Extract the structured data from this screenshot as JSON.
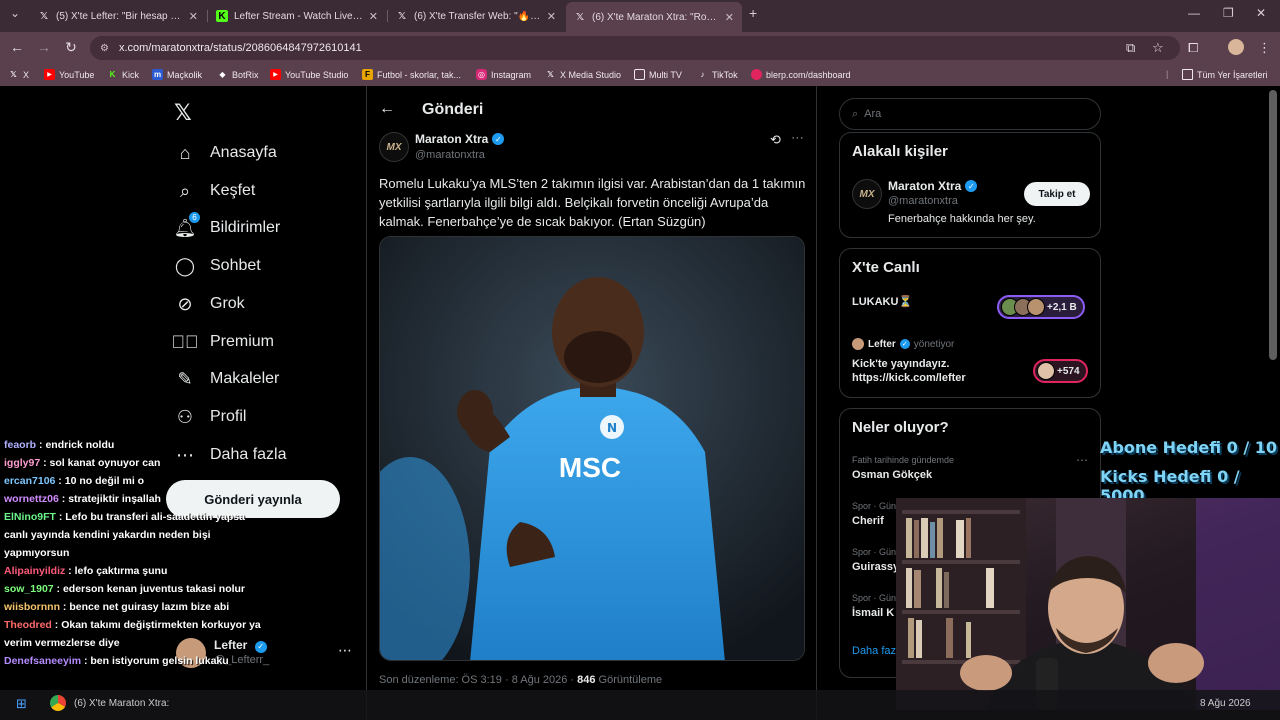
{
  "browser": {
    "tabs": [
      {
        "label": "(5) X'te Lefter: \"Bir hesap etmey",
        "favicon": "x-icon"
      },
      {
        "label": "Lefter Stream - Watch Live on K",
        "favicon": "kick-icon"
      },
      {
        "label": "(6) X'te Transfer Web: \"🔥 FOR",
        "favicon": "x-icon"
      },
      {
        "label": "(6) X'te Maraton Xtra: \"Romelu",
        "favicon": "x-icon"
      }
    ],
    "new_tab": "+",
    "url": "x.com/maratonxtra/status/2086064847972610141",
    "bookmarks": [
      {
        "label": "X"
      },
      {
        "label": "YouTube"
      },
      {
        "label": "Kick"
      },
      {
        "label": "Maçkolik"
      },
      {
        "label": "BotRix"
      },
      {
        "label": "YouTube Studio"
      },
      {
        "label": "Futbol - skorlar, tak..."
      },
      {
        "label": "Instagram"
      },
      {
        "label": "X Media Studio"
      },
      {
        "label": "Multi TV"
      },
      {
        "label": "TikTok"
      },
      {
        "label": "blerp.com/dashboard"
      }
    ],
    "all_bookmarks": "Tüm Yer İşaretleri"
  },
  "nav": {
    "items": [
      {
        "label": "Anasayfa",
        "icon": "home-icon"
      },
      {
        "label": "Keşfet",
        "icon": "search-icon"
      },
      {
        "label": "Bildirimler",
        "icon": "bell-icon",
        "badge": "6"
      },
      {
        "label": "Sohbet",
        "icon": "chat-icon"
      },
      {
        "label": "Grok",
        "icon": "grok-icon"
      },
      {
        "label": "Premium",
        "icon": "premium-icon"
      },
      {
        "label": "Makaleler",
        "icon": "articles-icon"
      },
      {
        "label": "Profil",
        "icon": "person-icon"
      },
      {
        "label": "Daha fazla",
        "icon": "more-circle-icon"
      }
    ],
    "post_button": "Gönderi yayınla",
    "account": {
      "name": "Lefter",
      "handle": "@_Lefterr_"
    }
  },
  "main": {
    "title": "Gönderi",
    "post": {
      "avatar_text": "MX",
      "name": "Maraton Xtra",
      "handle": "@maratonxtra",
      "text": "Romelu Lukaku’ya MLS’ten 2 takımın ilgisi var. Arabistan’dan da 1 takımın yetkilisi şartlarıyla ilgili bilgi aldı. Belçikalı forvetin önceliği Avrupa’da kalmak. Fenerbahçe’ye de sıcak bakıyor. (Ertan Süzgün)",
      "image_alt_text": "MSC",
      "meta_prefix": "Son düzenleme: ÖS 3:19 · 8 Ağu 2026 · ",
      "views_count": "846",
      "views_label": " Görüntüleme"
    }
  },
  "right": {
    "search_placeholder": "Ara",
    "related": {
      "title": "Alakalı kişiler",
      "name": "Maraton Xtra",
      "handle": "@maratonxtra",
      "bio": "Fenerbahçe hakkında her şey.",
      "follow": "Takip et"
    },
    "live": {
      "title": "X'te Canlı",
      "item1_title": "LUKAKU⏳",
      "item1_count": "+2,1 B",
      "item2_host": "Lefter",
      "item2_role": "yönetiyor",
      "item2_title": "Kick'te yayındayız. https://kick.com/lefter",
      "item2_count": "+574"
    },
    "trends": {
      "title": "Neler oluyor?",
      "items": [
        {
          "meta": "Fatih tarihinde gündemde",
          "name": "Osman Gökçek"
        },
        {
          "meta": "Spor · Günd",
          "name": "Cherif"
        },
        {
          "meta": "Spor · Gün",
          "name": "Guirassy"
        },
        {
          "meta": "Spor · Gün",
          "name": "İsmail K"
        }
      ],
      "more": "Daha faz"
    }
  },
  "overlay": {
    "goals": [
      "Abone Hedefi 0 / 10",
      "Kicks Hedefi 0 / 5000"
    ],
    "chat": [
      {
        "user": "feaorb",
        "msg": "endrick noldu",
        "color": "#b0b0ff"
      },
      {
        "user": "iggly97",
        "msg": "sol kanat oynuyor can",
        "color": "#ff9ed0"
      },
      {
        "user": "ercan7106",
        "msg": "10 no değil mi o",
        "color": "#7ec8ff"
      },
      {
        "user": "wornettz06",
        "msg": "stratejiktir inşallah",
        "color": "#d08cff"
      },
      {
        "user": "ElNino9FT",
        "msg": "Lefo bu transferi ali-saadettin yapsa canlı yayında kendini yakardın neden bişi yapmıyorsun",
        "color": "#6cf58a"
      },
      {
        "user": "Alipainyildiz",
        "msg": "lefo çaktırma şunu",
        "color": "#ff5a7a"
      },
      {
        "user": "sow_1907",
        "msg": "ederson kenan juventus takasi nolur",
        "color": "#7dfc7d"
      },
      {
        "user": "wiisbornnn",
        "msg": "bence net guirasy lazım bize abi",
        "color": "#f5c46a"
      },
      {
        "user": "Theodred",
        "msg": "Okan takımı değiştirmekten korkuyor ya verim vermezlerse diye",
        "color": "#ff6b6b"
      },
      {
        "user": "Denefsaneeyim",
        "msg": "ben istiyorum gelsin lukaku",
        "color": "#b58cff"
      }
    ]
  },
  "taskbar": {
    "window_label": "(6) X'te Maraton Xtra:",
    "date": "8 Ağu 2026"
  },
  "colors": {
    "accent": "#1d9bf0",
    "chrome_tab": "#3b2b34",
    "chrome_toolbar": "#5a3f4c",
    "live_ring": "#8b5cf6",
    "live_ring_2": "#e0245e"
  }
}
